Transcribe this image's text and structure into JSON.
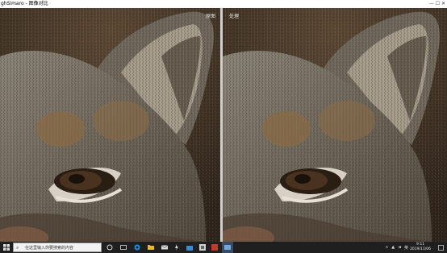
{
  "window": {
    "title": "ghSimaro - 图像对比",
    "controls": "—  ☐  ✕"
  },
  "panes": {
    "left_label": "原图",
    "right_label": "处理"
  },
  "taskbar": {
    "search_placeholder": "在这里输入你要搜索的内容",
    "time": "9:11",
    "date": "2019/11/06",
    "language": "英"
  },
  "icons": [
    "windows-start-icon",
    "search-icon",
    "task-view-icon",
    "edge-icon",
    "file-explorer-icon",
    "mail-icon",
    "app-icon",
    "store-icon",
    "settings-icon",
    "photos-icon",
    "active-app-icon",
    "network-icon",
    "volume-icon",
    "notification-icon"
  ],
  "colors": {
    "titlebar_bg": "#ffffff",
    "taskbar_bg": "#1f1f1f",
    "divider": "#cfcfcf"
  }
}
